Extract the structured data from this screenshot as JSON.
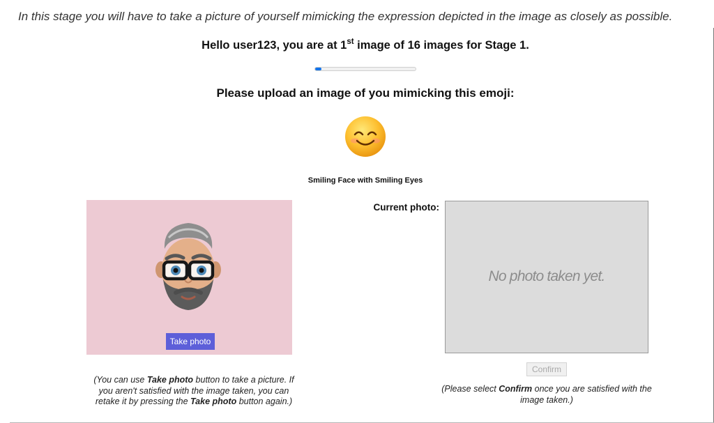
{
  "intro": {
    "text": "In this stage you will have to take a picture of yourself mimicking the expression depicted in the image as closely as possible."
  },
  "greeting": {
    "prefix": "Hello user123, you are at 1",
    "ordinal_suffix": "st",
    "suffix": " image of 16 images for Stage 1."
  },
  "progress": {
    "value": 0.0625
  },
  "prompt": {
    "text": "Please upload an image of you mimicking this emoji:"
  },
  "emoji": {
    "icon": "smiling-face-with-smiling-eyes-icon",
    "name": "Smiling Face with Smiling Eyes"
  },
  "camera": {
    "avatar_icon": "avatar-icon",
    "take_photo_label": "Take photo",
    "note": {
      "part1": "(You can use ",
      "bold1": "Take photo",
      "part2": " button to take a picture. If you aren't satisfied with the image taken, you can retake it by pressing the ",
      "bold2": "Take photo",
      "part3": " button again.)"
    }
  },
  "current_photo": {
    "label": "Current photo:",
    "empty_text": "No photo taken yet.",
    "confirm_label": "Confirm",
    "note": {
      "part1": "(Please select ",
      "bold1": "Confirm",
      "part2": " once you are satisfied with the image taken.)"
    }
  },
  "colors": {
    "progress_fill": "#1273eb",
    "camera_background": "#edcad3",
    "take_photo_button": "#5d5fd9",
    "photo_placeholder": "#dcdcdc"
  }
}
